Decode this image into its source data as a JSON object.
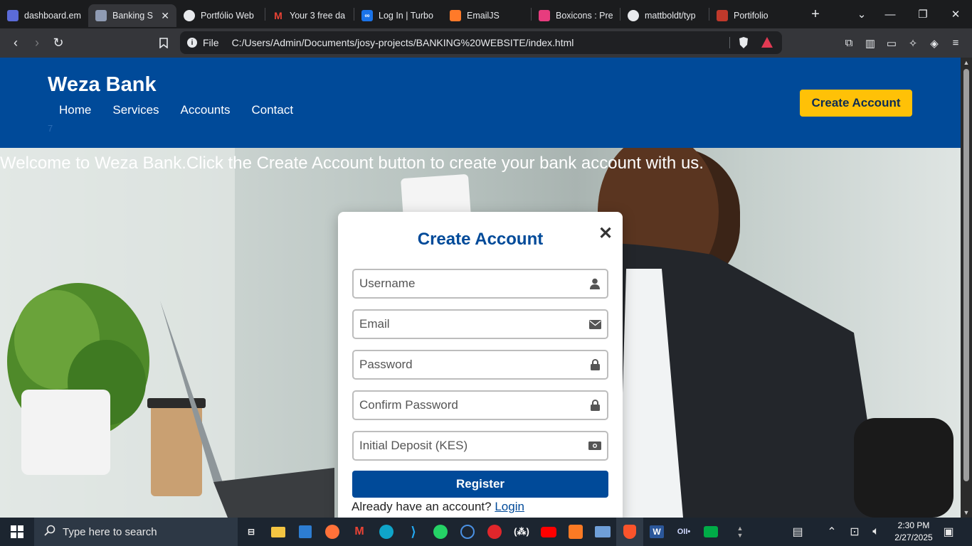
{
  "browser": {
    "tabs": [
      {
        "title": "dashboard.em",
        "color": "#5b6bd8",
        "active": false
      },
      {
        "title": "Banking S",
        "color": "#8f9bb3",
        "active": true
      },
      {
        "title": "Portfólio Web",
        "color": "#e8eaed",
        "active": false
      },
      {
        "title": "Your 3 free da",
        "color": "#ea4335",
        "active": false
      },
      {
        "title": "Log In | Turbo",
        "color": "#1a73e8",
        "active": false
      },
      {
        "title": "EmailJS",
        "color": "#ff7a29",
        "active": false
      },
      {
        "title": "Boxicons : Pre",
        "color": "#e73c7e",
        "active": false
      },
      {
        "title": "mattboldt/typ",
        "color": "#e8eaed",
        "active": false
      },
      {
        "title": "Portifolio",
        "color": "#c0392b",
        "active": false
      }
    ],
    "new_tab": "+",
    "address_scheme": "File",
    "address_url": "C:/Users/Admin/Documents/josy-projects/BANKING%20WEBSITE/index.html"
  },
  "site": {
    "brand": "Weza Bank",
    "nav": [
      "Home",
      "Services",
      "Accounts",
      "Contact"
    ],
    "stray_text": "7",
    "cta_label": "Create Account",
    "hero_text": "Welcome to Weza Bank.Click the Create Account button to create your bank account with us."
  },
  "modal": {
    "title": "Create Account",
    "close": "✕",
    "fields": [
      {
        "placeholder": "Username",
        "icon": "user-icon"
      },
      {
        "placeholder": "Email",
        "icon": "envelope-icon"
      },
      {
        "placeholder": "Password",
        "icon": "lock-icon"
      },
      {
        "placeholder": "Confirm Password",
        "icon": "lock-icon"
      },
      {
        "placeholder": "Initial Deposit (KES)",
        "icon": "money-icon"
      }
    ],
    "register_label": "Register",
    "already_text": "Already have an account?",
    "login_link": "Login"
  },
  "taskbar": {
    "search_placeholder": "Type here to search",
    "time": "2:30 PM",
    "date": "2/27/2025"
  }
}
